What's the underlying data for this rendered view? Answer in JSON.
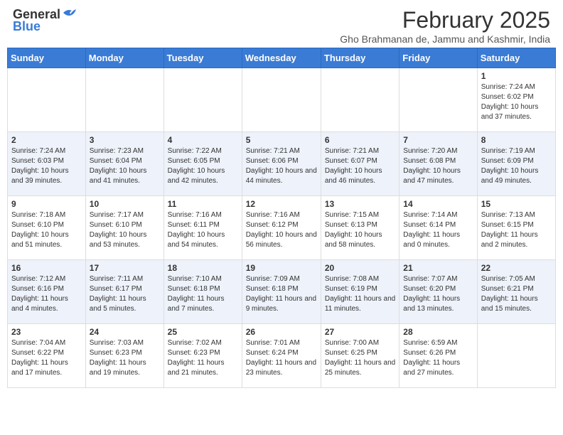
{
  "logo": {
    "general": "General",
    "blue": "Blue"
  },
  "header": {
    "month": "February 2025",
    "location": "Gho Brahmanan de, Jammu and Kashmir, India"
  },
  "weekdays": [
    "Sunday",
    "Monday",
    "Tuesday",
    "Wednesday",
    "Thursday",
    "Friday",
    "Saturday"
  ],
  "weeks": [
    [
      {
        "day": "",
        "info": ""
      },
      {
        "day": "",
        "info": ""
      },
      {
        "day": "",
        "info": ""
      },
      {
        "day": "",
        "info": ""
      },
      {
        "day": "",
        "info": ""
      },
      {
        "day": "",
        "info": ""
      },
      {
        "day": "1",
        "info": "Sunrise: 7:24 AM\nSunset: 6:02 PM\nDaylight: 10 hours and 37 minutes."
      }
    ],
    [
      {
        "day": "2",
        "info": "Sunrise: 7:24 AM\nSunset: 6:03 PM\nDaylight: 10 hours and 39 minutes."
      },
      {
        "day": "3",
        "info": "Sunrise: 7:23 AM\nSunset: 6:04 PM\nDaylight: 10 hours and 41 minutes."
      },
      {
        "day": "4",
        "info": "Sunrise: 7:22 AM\nSunset: 6:05 PM\nDaylight: 10 hours and 42 minutes."
      },
      {
        "day": "5",
        "info": "Sunrise: 7:21 AM\nSunset: 6:06 PM\nDaylight: 10 hours and 44 minutes."
      },
      {
        "day": "6",
        "info": "Sunrise: 7:21 AM\nSunset: 6:07 PM\nDaylight: 10 hours and 46 minutes."
      },
      {
        "day": "7",
        "info": "Sunrise: 7:20 AM\nSunset: 6:08 PM\nDaylight: 10 hours and 47 minutes."
      },
      {
        "day": "8",
        "info": "Sunrise: 7:19 AM\nSunset: 6:09 PM\nDaylight: 10 hours and 49 minutes."
      }
    ],
    [
      {
        "day": "9",
        "info": "Sunrise: 7:18 AM\nSunset: 6:10 PM\nDaylight: 10 hours and 51 minutes."
      },
      {
        "day": "10",
        "info": "Sunrise: 7:17 AM\nSunset: 6:10 PM\nDaylight: 10 hours and 53 minutes."
      },
      {
        "day": "11",
        "info": "Sunrise: 7:16 AM\nSunset: 6:11 PM\nDaylight: 10 hours and 54 minutes."
      },
      {
        "day": "12",
        "info": "Sunrise: 7:16 AM\nSunset: 6:12 PM\nDaylight: 10 hours and 56 minutes."
      },
      {
        "day": "13",
        "info": "Sunrise: 7:15 AM\nSunset: 6:13 PM\nDaylight: 10 hours and 58 minutes."
      },
      {
        "day": "14",
        "info": "Sunrise: 7:14 AM\nSunset: 6:14 PM\nDaylight: 11 hours and 0 minutes."
      },
      {
        "day": "15",
        "info": "Sunrise: 7:13 AM\nSunset: 6:15 PM\nDaylight: 11 hours and 2 minutes."
      }
    ],
    [
      {
        "day": "16",
        "info": "Sunrise: 7:12 AM\nSunset: 6:16 PM\nDaylight: 11 hours and 4 minutes."
      },
      {
        "day": "17",
        "info": "Sunrise: 7:11 AM\nSunset: 6:17 PM\nDaylight: 11 hours and 5 minutes."
      },
      {
        "day": "18",
        "info": "Sunrise: 7:10 AM\nSunset: 6:18 PM\nDaylight: 11 hours and 7 minutes."
      },
      {
        "day": "19",
        "info": "Sunrise: 7:09 AM\nSunset: 6:18 PM\nDaylight: 11 hours and 9 minutes."
      },
      {
        "day": "20",
        "info": "Sunrise: 7:08 AM\nSunset: 6:19 PM\nDaylight: 11 hours and 11 minutes."
      },
      {
        "day": "21",
        "info": "Sunrise: 7:07 AM\nSunset: 6:20 PM\nDaylight: 11 hours and 13 minutes."
      },
      {
        "day": "22",
        "info": "Sunrise: 7:05 AM\nSunset: 6:21 PM\nDaylight: 11 hours and 15 minutes."
      }
    ],
    [
      {
        "day": "23",
        "info": "Sunrise: 7:04 AM\nSunset: 6:22 PM\nDaylight: 11 hours and 17 minutes."
      },
      {
        "day": "24",
        "info": "Sunrise: 7:03 AM\nSunset: 6:23 PM\nDaylight: 11 hours and 19 minutes."
      },
      {
        "day": "25",
        "info": "Sunrise: 7:02 AM\nSunset: 6:23 PM\nDaylight: 11 hours and 21 minutes."
      },
      {
        "day": "26",
        "info": "Sunrise: 7:01 AM\nSunset: 6:24 PM\nDaylight: 11 hours and 23 minutes."
      },
      {
        "day": "27",
        "info": "Sunrise: 7:00 AM\nSunset: 6:25 PM\nDaylight: 11 hours and 25 minutes."
      },
      {
        "day": "28",
        "info": "Sunrise: 6:59 AM\nSunset: 6:26 PM\nDaylight: 11 hours and 27 minutes."
      },
      {
        "day": "",
        "info": ""
      }
    ]
  ]
}
